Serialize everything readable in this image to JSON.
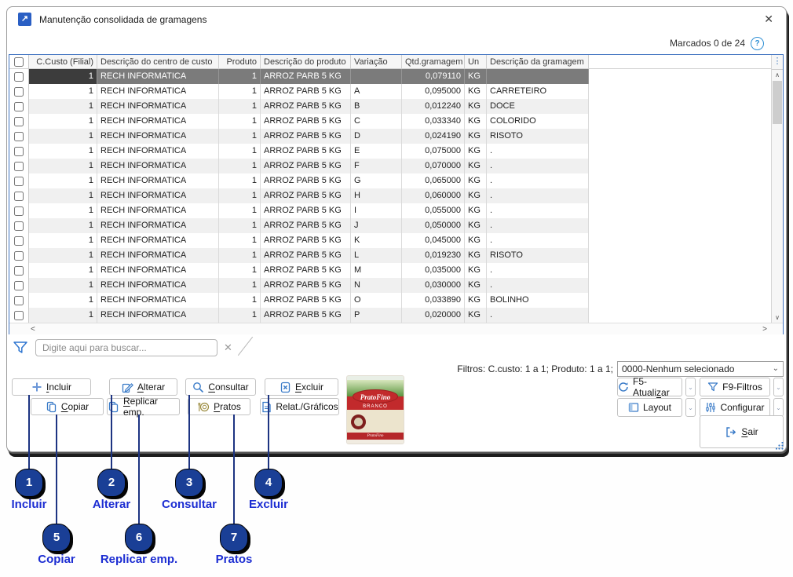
{
  "window": {
    "title": "Manutenção consolidada de gramagens",
    "marcados": "Marcados 0 de 24"
  },
  "icons": {
    "close": "✕",
    "help": "?",
    "more": "⋮",
    "up": "∧",
    "down": "∨",
    "left": "<",
    "right": ">",
    "chevron": "⌄",
    "window_arrow": "↗"
  },
  "search": {
    "placeholder": "Digite aqui para buscar..."
  },
  "filters": {
    "summary": "Filtros: C.custo: 1 a 1; Produto: 1 a 1;",
    "dropdown": "0000-Nenhum selecionado"
  },
  "actions": {
    "incluir": "Incluir",
    "alterar": "Alterar",
    "consultar": "Consultar",
    "excluir": "Excluir",
    "copiar": "Copiar",
    "replicar": "Replicar emp.",
    "pratos": "Pratos",
    "relat": "Relat./Gráficos",
    "f5": "F5-Atualizar",
    "f9": "F9-Filtros",
    "layout": "Layout",
    "configurar": "Configurar",
    "sair": "Sair"
  },
  "product": {
    "brand": "PratoFino",
    "variant": "BRANCO"
  },
  "table": {
    "columns": [
      "",
      "C.Custo (Filial)",
      "Descrição do centro de custo",
      "Produto",
      "Descrição do produto",
      "Variação",
      "Qtd.gramagem",
      "Un",
      "Descrição da gramagem"
    ],
    "rows": [
      {
        "ccusto": "1",
        "centro": "RECH INFORMATICA",
        "produto": "1",
        "desc_produto": "ARROZ PARB 5 KG",
        "variacao": "",
        "qtd": "0,079110",
        "un": "KG",
        "desc_gram": ""
      },
      {
        "ccusto": "1",
        "centro": "RECH INFORMATICA",
        "produto": "1",
        "desc_produto": "ARROZ PARB 5 KG",
        "variacao": "A",
        "qtd": "0,095000",
        "un": "KG",
        "desc_gram": "CARRETEIRO"
      },
      {
        "ccusto": "1",
        "centro": "RECH INFORMATICA",
        "produto": "1",
        "desc_produto": "ARROZ PARB 5 KG",
        "variacao": "B",
        "qtd": "0,012240",
        "un": "KG",
        "desc_gram": "DOCE"
      },
      {
        "ccusto": "1",
        "centro": "RECH INFORMATICA",
        "produto": "1",
        "desc_produto": "ARROZ PARB 5 KG",
        "variacao": "C",
        "qtd": "0,033340",
        "un": "KG",
        "desc_gram": "COLORIDO"
      },
      {
        "ccusto": "1",
        "centro": "RECH INFORMATICA",
        "produto": "1",
        "desc_produto": "ARROZ PARB 5 KG",
        "variacao": "D",
        "qtd": "0,024190",
        "un": "KG",
        "desc_gram": "RISOTO"
      },
      {
        "ccusto": "1",
        "centro": "RECH INFORMATICA",
        "produto": "1",
        "desc_produto": "ARROZ PARB 5 KG",
        "variacao": "E",
        "qtd": "0,075000",
        "un": "KG",
        "desc_gram": "."
      },
      {
        "ccusto": "1",
        "centro": "RECH INFORMATICA",
        "produto": "1",
        "desc_produto": "ARROZ PARB 5 KG",
        "variacao": "F",
        "qtd": "0,070000",
        "un": "KG",
        "desc_gram": "."
      },
      {
        "ccusto": "1",
        "centro": "RECH INFORMATICA",
        "produto": "1",
        "desc_produto": "ARROZ PARB 5 KG",
        "variacao": "G",
        "qtd": "0,065000",
        "un": "KG",
        "desc_gram": "."
      },
      {
        "ccusto": "1",
        "centro": "RECH INFORMATICA",
        "produto": "1",
        "desc_produto": "ARROZ PARB 5 KG",
        "variacao": "H",
        "qtd": "0,060000",
        "un": "KG",
        "desc_gram": "."
      },
      {
        "ccusto": "1",
        "centro": "RECH INFORMATICA",
        "produto": "1",
        "desc_produto": "ARROZ PARB 5 KG",
        "variacao": "I",
        "qtd": "0,055000",
        "un": "KG",
        "desc_gram": "."
      },
      {
        "ccusto": "1",
        "centro": "RECH INFORMATICA",
        "produto": "1",
        "desc_produto": "ARROZ PARB 5 KG",
        "variacao": "J",
        "qtd": "0,050000",
        "un": "KG",
        "desc_gram": "."
      },
      {
        "ccusto": "1",
        "centro": "RECH INFORMATICA",
        "produto": "1",
        "desc_produto": "ARROZ PARB 5 KG",
        "variacao": "K",
        "qtd": "0,045000",
        "un": "KG",
        "desc_gram": "."
      },
      {
        "ccusto": "1",
        "centro": "RECH INFORMATICA",
        "produto": "1",
        "desc_produto": "ARROZ PARB 5 KG",
        "variacao": "L",
        "qtd": "0,019230",
        "un": "KG",
        "desc_gram": "RISOTO"
      },
      {
        "ccusto": "1",
        "centro": "RECH INFORMATICA",
        "produto": "1",
        "desc_produto": "ARROZ PARB 5 KG",
        "variacao": "M",
        "qtd": "0,035000",
        "un": "KG",
        "desc_gram": "."
      },
      {
        "ccusto": "1",
        "centro": "RECH INFORMATICA",
        "produto": "1",
        "desc_produto": "ARROZ PARB 5 KG",
        "variacao": "N",
        "qtd": "0,030000",
        "un": "KG",
        "desc_gram": "."
      },
      {
        "ccusto": "1",
        "centro": "RECH INFORMATICA",
        "produto": "1",
        "desc_produto": "ARROZ PARB 5 KG",
        "variacao": "O",
        "qtd": "0,033890",
        "un": "KG",
        "desc_gram": "BOLINHO"
      },
      {
        "ccusto": "1",
        "centro": "RECH INFORMATICA",
        "produto": "1",
        "desc_produto": "ARROZ PARB 5 KG",
        "variacao": "P",
        "qtd": "0,020000",
        "un": "KG",
        "desc_gram": "."
      }
    ]
  },
  "annotations": [
    {
      "n": "1",
      "label": "Incluir"
    },
    {
      "n": "2",
      "label": "Alterar"
    },
    {
      "n": "3",
      "label": "Consultar"
    },
    {
      "n": "4",
      "label": "Excluir"
    },
    {
      "n": "5",
      "label": "Copiar"
    },
    {
      "n": "6",
      "label": "Replicar emp."
    },
    {
      "n": "7",
      "label": "Pratos"
    }
  ]
}
